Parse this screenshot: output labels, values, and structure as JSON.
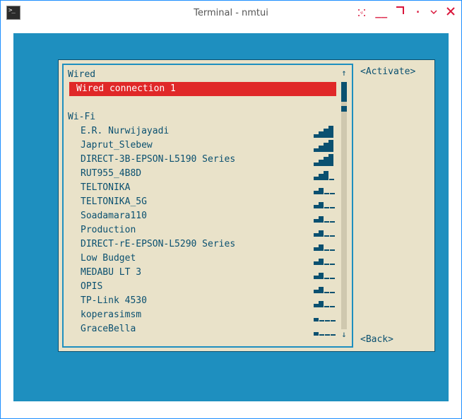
{
  "window": {
    "title": "Terminal - nmtui"
  },
  "sections": {
    "wired_header": "Wired",
    "wifi_header": "Wi-Fi"
  },
  "wired_connections": [
    {
      "name": "Wired connection 1",
      "selected": true
    }
  ],
  "wifi_networks": [
    {
      "name": "E.R. Nurwijayadi",
      "signal": 4
    },
    {
      "name": "Japrut_Slebew",
      "signal": 4
    },
    {
      "name": "DIRECT-3B-EPSON-L5190 Series",
      "signal": 4
    },
    {
      "name": "RUT955_4B8D",
      "signal": 3
    },
    {
      "name": "TELTONIKA",
      "signal": 2
    },
    {
      "name": "TELTONIKA_5G",
      "signal": 2
    },
    {
      "name": "Soadamara110",
      "signal": 2
    },
    {
      "name": "Production",
      "signal": 2
    },
    {
      "name": "DIRECT-rE-EPSON-L5290 Series",
      "signal": 2
    },
    {
      "name": "Low Budget",
      "signal": 2
    },
    {
      "name": "MEDABU LT 3",
      "signal": 2
    },
    {
      "name": "OPIS",
      "signal": 2
    },
    {
      "name": "TP-Link 4530",
      "signal": 2
    },
    {
      "name": "koperasimsm",
      "signal": 1
    },
    {
      "name": "GraceBella",
      "signal": 1
    }
  ],
  "buttons": {
    "activate": "<Activate>",
    "back": "<Back>"
  }
}
